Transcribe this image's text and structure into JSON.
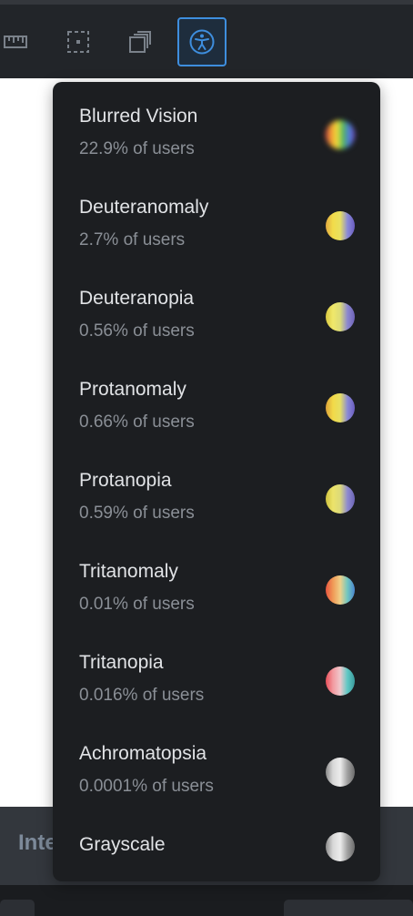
{
  "toolbar": {
    "tools": [
      {
        "icon": "ruler-icon",
        "active": false
      },
      {
        "icon": "select-frame-icon",
        "active": false
      },
      {
        "icon": "layers-icon",
        "active": false
      },
      {
        "icon": "accessibility-icon",
        "active": true
      }
    ],
    "accent": "#3e8ede"
  },
  "bottom_panel": {
    "tab_label": "Inte"
  },
  "vision_menu": {
    "items": [
      {
        "label": "Blurred Vision",
        "desc": "22.9% of users",
        "swatch": "blurred-spectrum"
      },
      {
        "label": "Deuteranomaly",
        "desc": "2.7% of users",
        "swatch": "deuteranomaly-spectrum"
      },
      {
        "label": "Deuteranopia",
        "desc": "0.56% of users",
        "swatch": "deuteranopia-spectrum"
      },
      {
        "label": "Protanomaly",
        "desc": "0.66% of users",
        "swatch": "protanomaly-spectrum"
      },
      {
        "label": "Protanopia",
        "desc": "0.59% of users",
        "swatch": "protanopia-spectrum"
      },
      {
        "label": "Tritanomaly",
        "desc": "0.01% of users",
        "swatch": "tritanomaly-spectrum"
      },
      {
        "label": "Tritanopia",
        "desc": "0.016% of users",
        "swatch": "tritanopia-spectrum"
      },
      {
        "label": "Achromatopsia",
        "desc": "0.0001% of users",
        "swatch": "achromatopsia-spectrum"
      },
      {
        "label": "Grayscale",
        "desc": "",
        "swatch": "grayscale-spectrum"
      }
    ]
  }
}
